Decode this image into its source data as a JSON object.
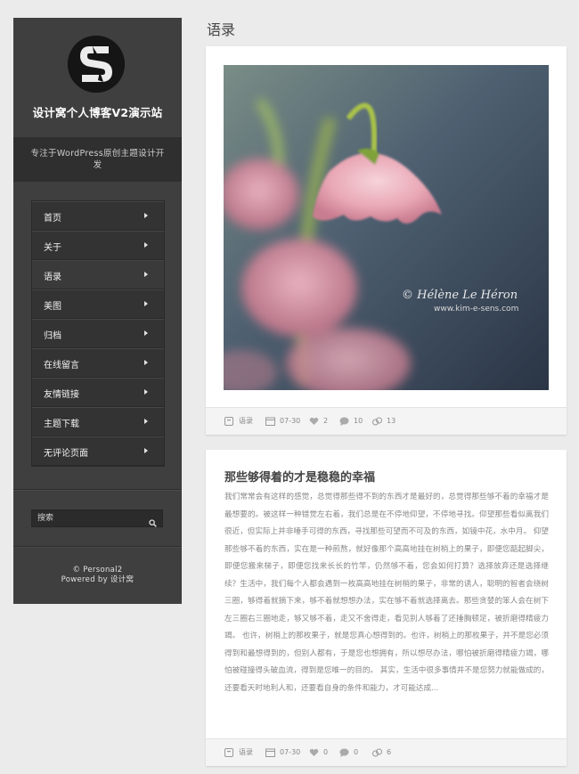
{
  "site": {
    "title": "设计窝个人博客V2演示站",
    "tagline": "专注于WordPress原创主题设计开发",
    "copyright": "© Personal2",
    "powered_by": "Powered by 设计窝"
  },
  "nav": {
    "items": [
      {
        "label": "首页"
      },
      {
        "label": "关于"
      },
      {
        "label": "语录"
      },
      {
        "label": "美图"
      },
      {
        "label": "归档"
      },
      {
        "label": "在线留言"
      },
      {
        "label": "友情链接"
      },
      {
        "label": "主题下载"
      },
      {
        "label": "无评论页面"
      }
    ],
    "active_index": 2
  },
  "search": {
    "placeholder": "搜索"
  },
  "page": {
    "heading": "语录"
  },
  "posts": [
    {
      "image_watermark": "© Hélène Le Héron",
      "image_url_text": "www.kim-e-sens.com",
      "meta": {
        "category": "语录",
        "date": "07-30",
        "likes": "2",
        "comments": "10",
        "views": "13"
      }
    },
    {
      "title": "那些够得着的才是稳稳的幸福",
      "excerpt": "我们常常会有这样的感觉，总觉得那些得不到的东西才是最好的，总觉得那些够不着的幸福才是最想要的。被这样一种错觉左右着，我们总是在不停地仰望，不停地寻找。仰望那些看似离我们很近，但实际上并非唾手可得的东西，寻找那些可望而不可及的东西，如镜中花，水中月。  仰望那些够不着的东西，实在是一种煎熬，就好像那个高高地挂在树梢上的果子，即便您踮起脚尖，即便您搬来梯子，即便您找来长长的竹竿，仍然够不着，您会如何打算？选择放弃还是选择继续？生活中，我们每个人都会遇到一枚高高地挂在树梢的果子，非常的诱人，聪明的智者会绕树三圈，够得着就摘下来，够不着就想想办法，实在够不着就选择离去。那些贪婪的笨人会在树下左三圈右三圈地走，够又够不着，走又不舍得走，看见别人够着了还捶胸顿足，被折磨得精疲力竭。  也许，树梢上的那枚果子，就是您真心想得到的。也许，树梢上的那枚果子，并不是您必须得到和最想得到的，但别人都有，于是您也想拥有，所以想尽办法，哪怕被折磨得精疲力竭，哪怕被碰撞得头破血流，得到是您唯一的目的。  其实，生活中很多事情并不是您努力就能做成的，还要看天时地利人和，还要看自身的条件和能力，才可能达成...",
      "meta": {
        "category": "语录",
        "date": "07-30",
        "likes": "0",
        "comments": "0",
        "views": "6"
      }
    }
  ],
  "colors": {
    "sidebar_bg": "#3f3f3f",
    "page_bg": "#ebebeb",
    "card_bg": "#ffffff"
  }
}
